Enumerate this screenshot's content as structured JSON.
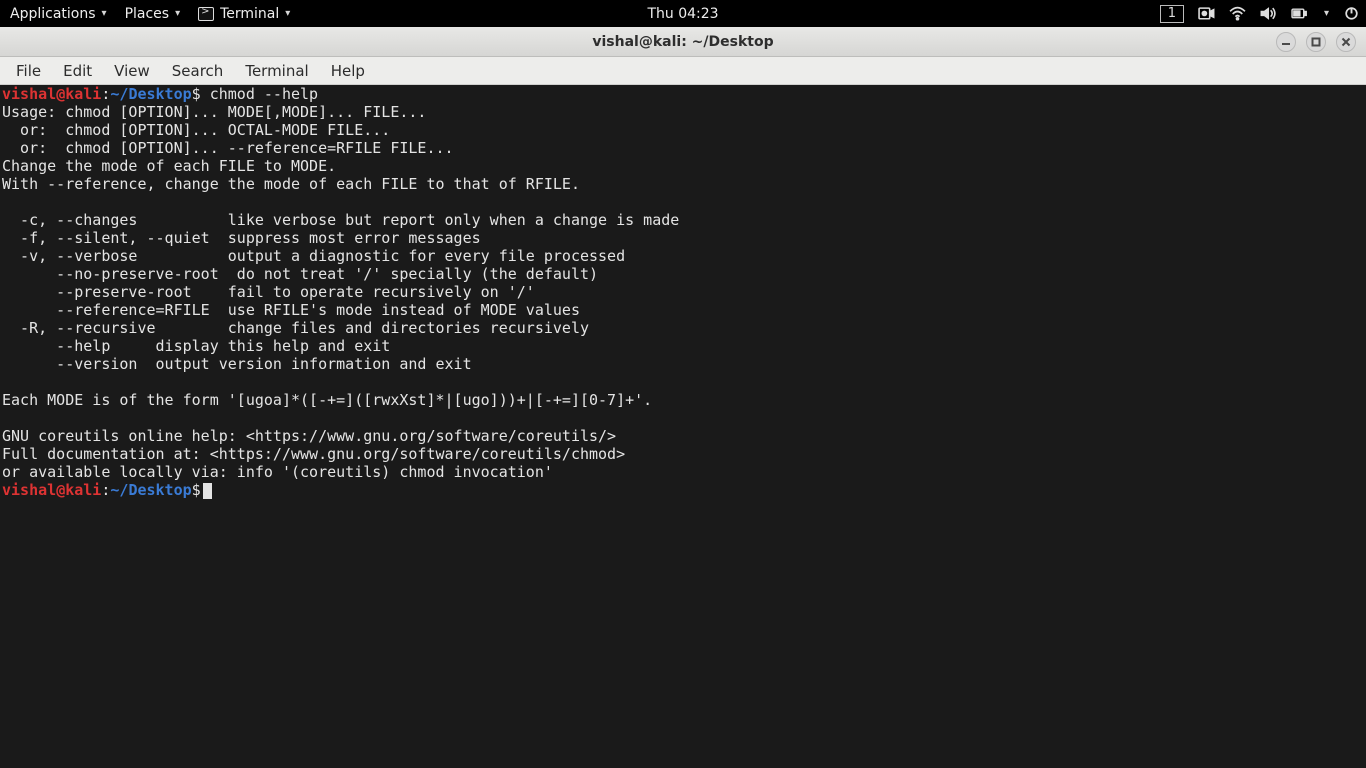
{
  "topbar": {
    "applications": "Applications",
    "places": "Places",
    "terminal": "Terminal",
    "clock": "Thu 04:23",
    "workspace": "1"
  },
  "window": {
    "title": "vishal@kali: ~/Desktop"
  },
  "menubar": {
    "file": "File",
    "edit": "Edit",
    "view": "View",
    "search": "Search",
    "terminal": "Terminal",
    "help": "Help"
  },
  "prompt": {
    "user": "vishal",
    "at": "@",
    "host": "kali",
    "colon": ":",
    "tilde": "~",
    "slash": "/",
    "dir": "Desktop",
    "dollar": "$"
  },
  "command1": " chmod --help",
  "output": "Usage: chmod [OPTION]... MODE[,MODE]... FILE...\n  or:  chmod [OPTION]... OCTAL-MODE FILE...\n  or:  chmod [OPTION]... --reference=RFILE FILE...\nChange the mode of each FILE to MODE.\nWith --reference, change the mode of each FILE to that of RFILE.\n\n  -c, --changes          like verbose but report only when a change is made\n  -f, --silent, --quiet  suppress most error messages\n  -v, --verbose          output a diagnostic for every file processed\n      --no-preserve-root  do not treat '/' specially (the default)\n      --preserve-root    fail to operate recursively on '/'\n      --reference=RFILE  use RFILE's mode instead of MODE values\n  -R, --recursive        change files and directories recursively\n      --help     display this help and exit\n      --version  output version information and exit\n\nEach MODE is of the form '[ugoa]*([-+=]([rwxXst]*|[ugo]))+|[-+=][0-7]+'.\n\nGNU coreutils online help: <https://www.gnu.org/software/coreutils/>\nFull documentation at: <https://www.gnu.org/software/coreutils/chmod>\nor available locally via: info '(coreutils) chmod invocation'"
}
